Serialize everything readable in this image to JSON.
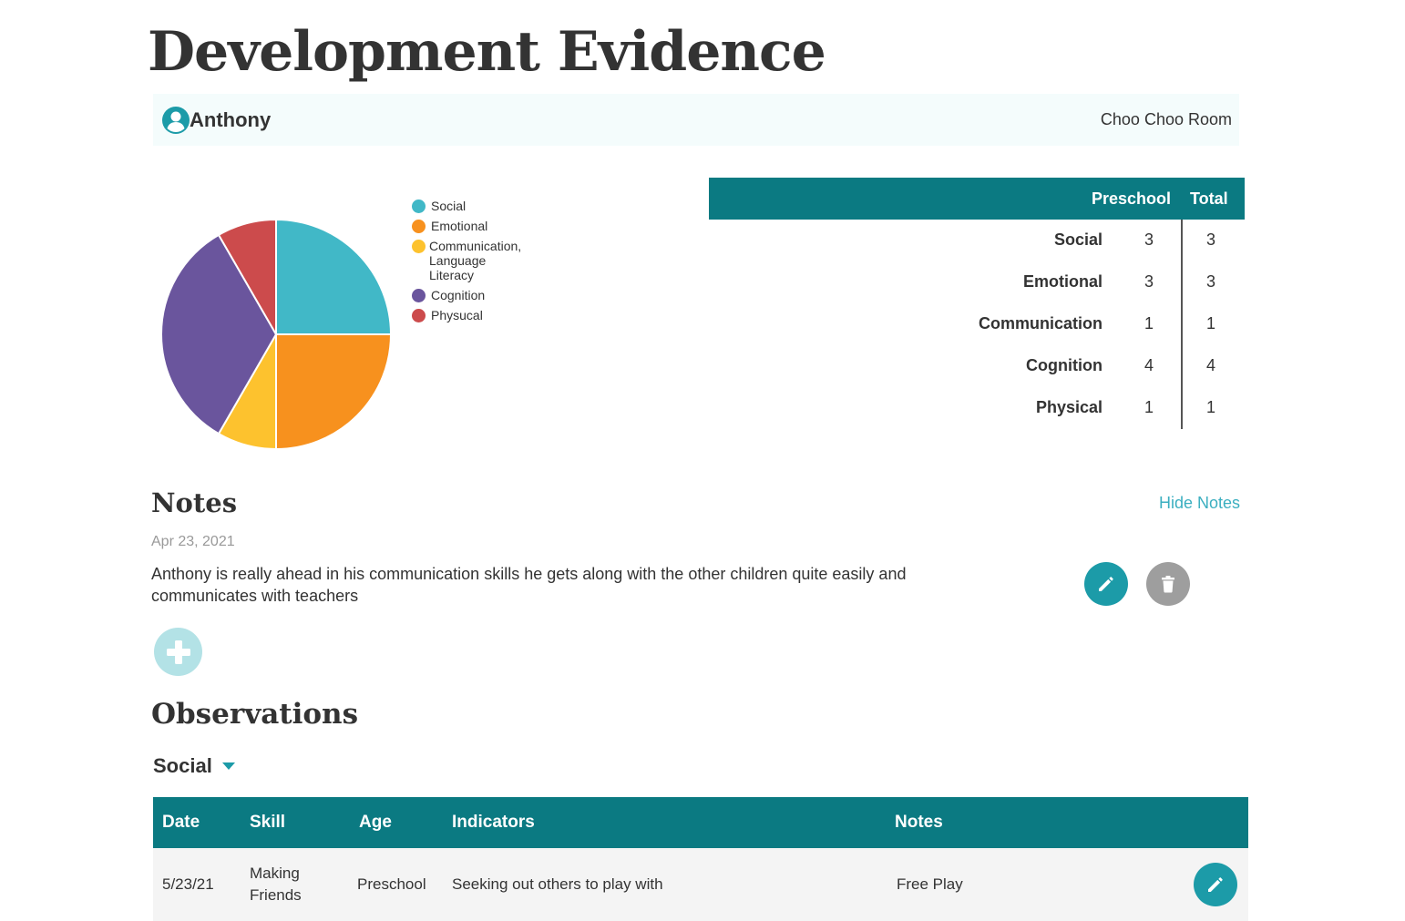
{
  "page": {
    "title": "Development Evidence"
  },
  "child": {
    "name": "Anthony",
    "room": "Choo Choo Room"
  },
  "chart_data": {
    "type": "pie",
    "title": "",
    "series": [
      {
        "name": "Social",
        "value": 3,
        "color": "#41b8c7"
      },
      {
        "name": "Emotional",
        "value": 3,
        "color": "#f7911e"
      },
      {
        "name": "Communication, Language Literacy",
        "value": 1,
        "color": "#fdc22e"
      },
      {
        "name": "Cognition",
        "value": 4,
        "color": "#6a559d"
      },
      {
        "name": "Physucal",
        "value": 1,
        "color": "#cc4b4c"
      }
    ],
    "legend": {
      "position": "right",
      "items": [
        {
          "label": "Social",
          "color": "#41b8c7"
        },
        {
          "label": "Emotional",
          "color": "#f7911e"
        },
        {
          "label": "Communication, Language Literacy",
          "lines": [
            "Communication,",
            "Language",
            "Literacy"
          ],
          "color": "#fdc22e"
        },
        {
          "label": "Cognition",
          "color": "#6a559d"
        },
        {
          "label": "Physucal",
          "color": "#cc4b4c"
        }
      ]
    }
  },
  "summary_table": {
    "headers": [
      "Preschool",
      "Total"
    ],
    "rows": [
      {
        "label": "Social",
        "preschool": "3",
        "total": "3"
      },
      {
        "label": "Emotional",
        "preschool": "3",
        "total": "3"
      },
      {
        "label": "Communication",
        "preschool": "1",
        "total": "1"
      },
      {
        "label": "Cognition",
        "preschool": "4",
        "total": "4"
      },
      {
        "label": "Physical",
        "preschool": "1",
        "total": "1"
      }
    ]
  },
  "notes": {
    "title": "Notes",
    "toggle_label": "Hide Notes",
    "items": [
      {
        "date": "Apr 23, 2021",
        "text": "Anthony is really ahead in his communication skills he gets along with the other children quite easily and communicates with teachers"
      }
    ]
  },
  "observations": {
    "title": "Observations",
    "filter_label": "Social",
    "columns": {
      "date": "Date",
      "skill": "Skill",
      "age": "Age",
      "indicators": "Indicators",
      "notes": "Notes"
    },
    "rows": [
      {
        "date": "5/23/21",
        "skill_line1": "Making",
        "skill_line2": "Friends",
        "age": "Preschool",
        "indicators": "Seeking out others to play with",
        "notes": "Free Play"
      }
    ]
  },
  "icons": {
    "avatar": "user-circle-icon",
    "edit": "pencil-icon",
    "delete": "trash-icon",
    "add": "plus-icon",
    "dropdown": "caret-down-icon"
  },
  "colors": {
    "header_teal": "#0b7a82",
    "accent_teal": "#1c9ba8",
    "link": "#3bafc0",
    "add_button": "#b3e2e6",
    "child_bar_bg": "#f4fcfc"
  }
}
